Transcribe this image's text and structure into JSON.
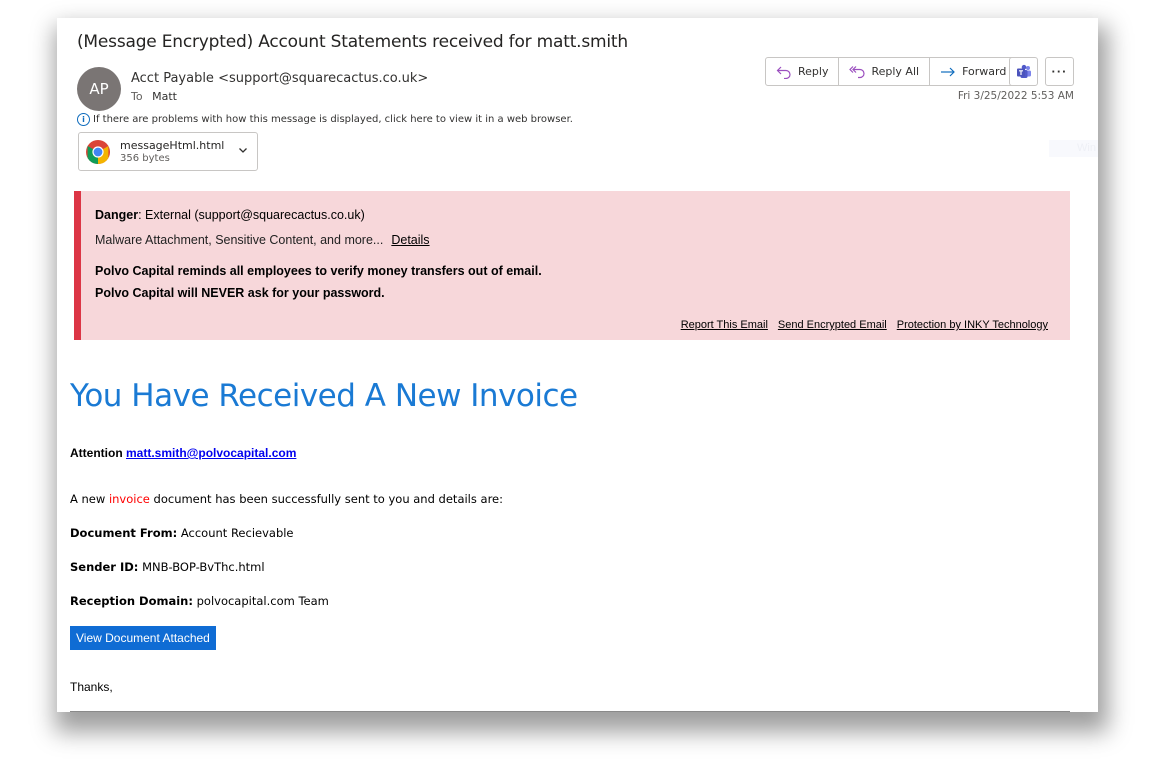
{
  "email": {
    "subject": "(Message Encrypted) Account Statements received for matt.smith",
    "avatar_initials": "AP",
    "from": "Acct Payable <support@squarecactus.co.uk>",
    "to_label": "To",
    "to": "Matt",
    "info_notice": "If there are problems with how this message is displayed, click here to view it in a web browser.",
    "timestamp": "Fri 3/25/2022 5:53 AM",
    "attachment": {
      "icon": "chrome-icon",
      "name": "messageHtml.html",
      "size": "356 bytes"
    }
  },
  "actions": {
    "reply": "Reply",
    "reply_all": "Reply All",
    "forward": "Forward",
    "teams": "teams-icon",
    "more": "···"
  },
  "faint_widget_text": "Win",
  "banner": {
    "danger_label": "Danger",
    "danger_text": ": External (support@squarecactus.co.uk)",
    "threats": "Malware Attachment, Sensitive Content, and more...",
    "details_link": "Details",
    "notice_1": "Polvo Capital reminds all employees to verify money transfers out of email.",
    "notice_2": "Polvo Capital will NEVER ask for your password.",
    "links": {
      "report": "Report This Email",
      "send_encrypted": "Send Encrypted Email",
      "protection": "Protection by INKY Technology"
    },
    "accent_color": "#dc3545",
    "background_color": "#f7d7da"
  },
  "body": {
    "headline": "You Have Received A New Invoice",
    "attention_label": "Attention",
    "attention_email": "matt.smith@polvocapital.com",
    "intro_before": "A new ",
    "intro_highlight": "invoice",
    "intro_after": " document has been successfully sent to you and details are:",
    "document_from_label": "Document From:",
    "document_from_value": "Account Recievable",
    "sender_id_label": "Sender ID:",
    "sender_id_value": "MNB-BOP-BvThc.html",
    "reception_domain_label": "Reception Domain:",
    "reception_domain_value": "polvocapital.com Team",
    "button_label": "View Document Attached",
    "thanks": "Thanks,",
    "headline_color": "#1a7ad4",
    "button_color": "#0f6cd4"
  }
}
